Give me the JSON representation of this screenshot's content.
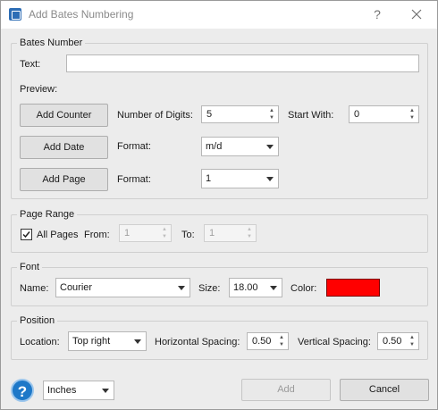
{
  "window": {
    "title": "Add Bates Numbering",
    "help_glyph": "?",
    "close_glyph": "✕"
  },
  "bates": {
    "group_title": "Bates Number",
    "text_label": "Text:",
    "text_value": "",
    "preview_label": "Preview:",
    "add_counter_label": "Add Counter",
    "digits_label": "Number of Digits:",
    "digits_value": "5",
    "start_label": "Start With:",
    "start_value": "0",
    "add_date_label": "Add Date",
    "date_format_label": "Format:",
    "date_format_value": "m/d",
    "add_page_label": "Add Page",
    "page_format_label": "Format:",
    "page_format_value": "1"
  },
  "page_range": {
    "group_title": "Page Range",
    "all_pages_label": "All Pages",
    "all_pages_checked": true,
    "from_label": "From:",
    "from_value": "1",
    "to_label": "To:",
    "to_value": "1"
  },
  "font": {
    "group_title": "Font",
    "name_label": "Name:",
    "name_value": "Courier",
    "size_label": "Size:",
    "size_value": "18.00",
    "color_label": "Color:",
    "color_value": "#ff0000"
  },
  "position": {
    "group_title": "Position",
    "location_label": "Location:",
    "location_value": "Top right",
    "hspacing_label": "Horizontal Spacing:",
    "hspacing_value": "0.50",
    "vspacing_label": "Vertical Spacing:",
    "vspacing_value": "0.50"
  },
  "footer": {
    "help_glyph": "?",
    "units_value": "Inches",
    "add_label": "Add",
    "cancel_label": "Cancel"
  },
  "icons": {
    "app": "bates-app-icon",
    "help": "question-mark-icon",
    "close": "close-icon",
    "dropdown": "chevron-down-icon",
    "spin": "spin-arrows-icon",
    "checkbox": "checkmark-icon"
  }
}
